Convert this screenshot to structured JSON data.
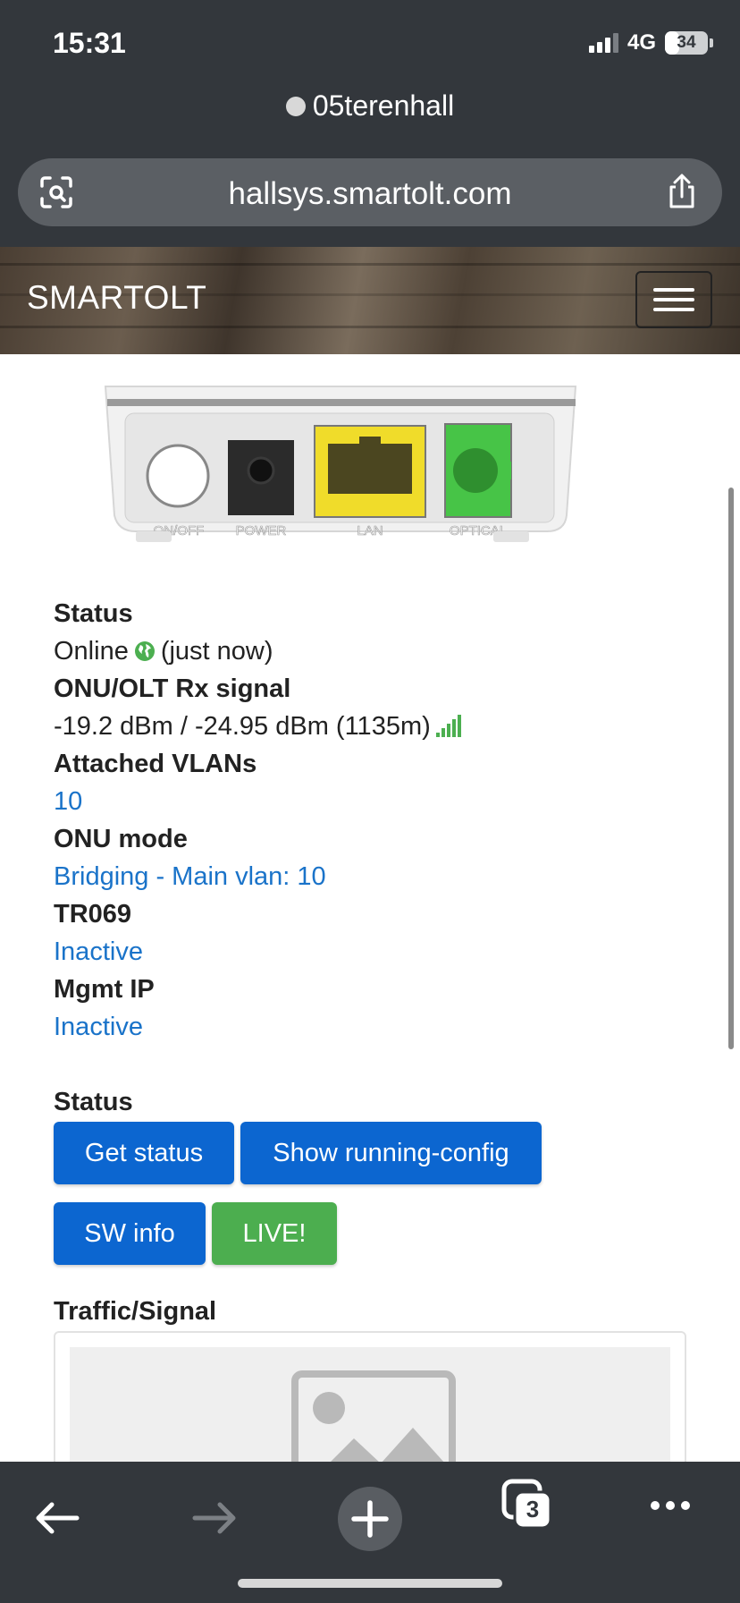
{
  "status_bar": {
    "time": "15:31",
    "network": "4G",
    "battery": "34",
    "battery_level_percent": 34
  },
  "browser": {
    "tab_title": "05terenhall",
    "url": "hallsys.smartolt.com",
    "tabs_count": "3",
    "icons": {
      "url_left": "reader-scan-icon",
      "share": "share-icon",
      "back": "back-arrow-icon",
      "forward": "forward-arrow-icon",
      "new_tab": "plus-icon",
      "tabs": "tabs-icon",
      "more": "more-icon"
    }
  },
  "site": {
    "brand": "SMARTOLT"
  },
  "device": {
    "port_labels": [
      "ON/OFF",
      "POWER",
      "LAN",
      "OPTICAL"
    ]
  },
  "info": {
    "status_label": "Status",
    "status_value": "Online",
    "status_time": "(just now)",
    "rx_label": "ONU/OLT Rx signal",
    "rx_value": "-19.2 dBm / -24.95 dBm (1135m)",
    "vlans_label": "Attached VLANs",
    "vlans_value": "10",
    "mode_label": "ONU mode",
    "mode_value": "Bridging - Main vlan: 10",
    "tr069_label": "TR069",
    "tr069_value": "Inactive",
    "mgmt_label": "Mgmt IP",
    "mgmt_value": "Inactive"
  },
  "actions": {
    "section_label": "Status",
    "get_status": "Get status",
    "show_running_config": "Show running-config",
    "sw_info": "SW info",
    "live": "LIVE!"
  },
  "traffic": {
    "label": "Traffic/Signal"
  },
  "colors": {
    "chrome": "#33373c",
    "link": "#1a73c9",
    "button_blue": "#0c66d0",
    "button_green": "#4cae4f",
    "online_green": "#4caf50"
  }
}
